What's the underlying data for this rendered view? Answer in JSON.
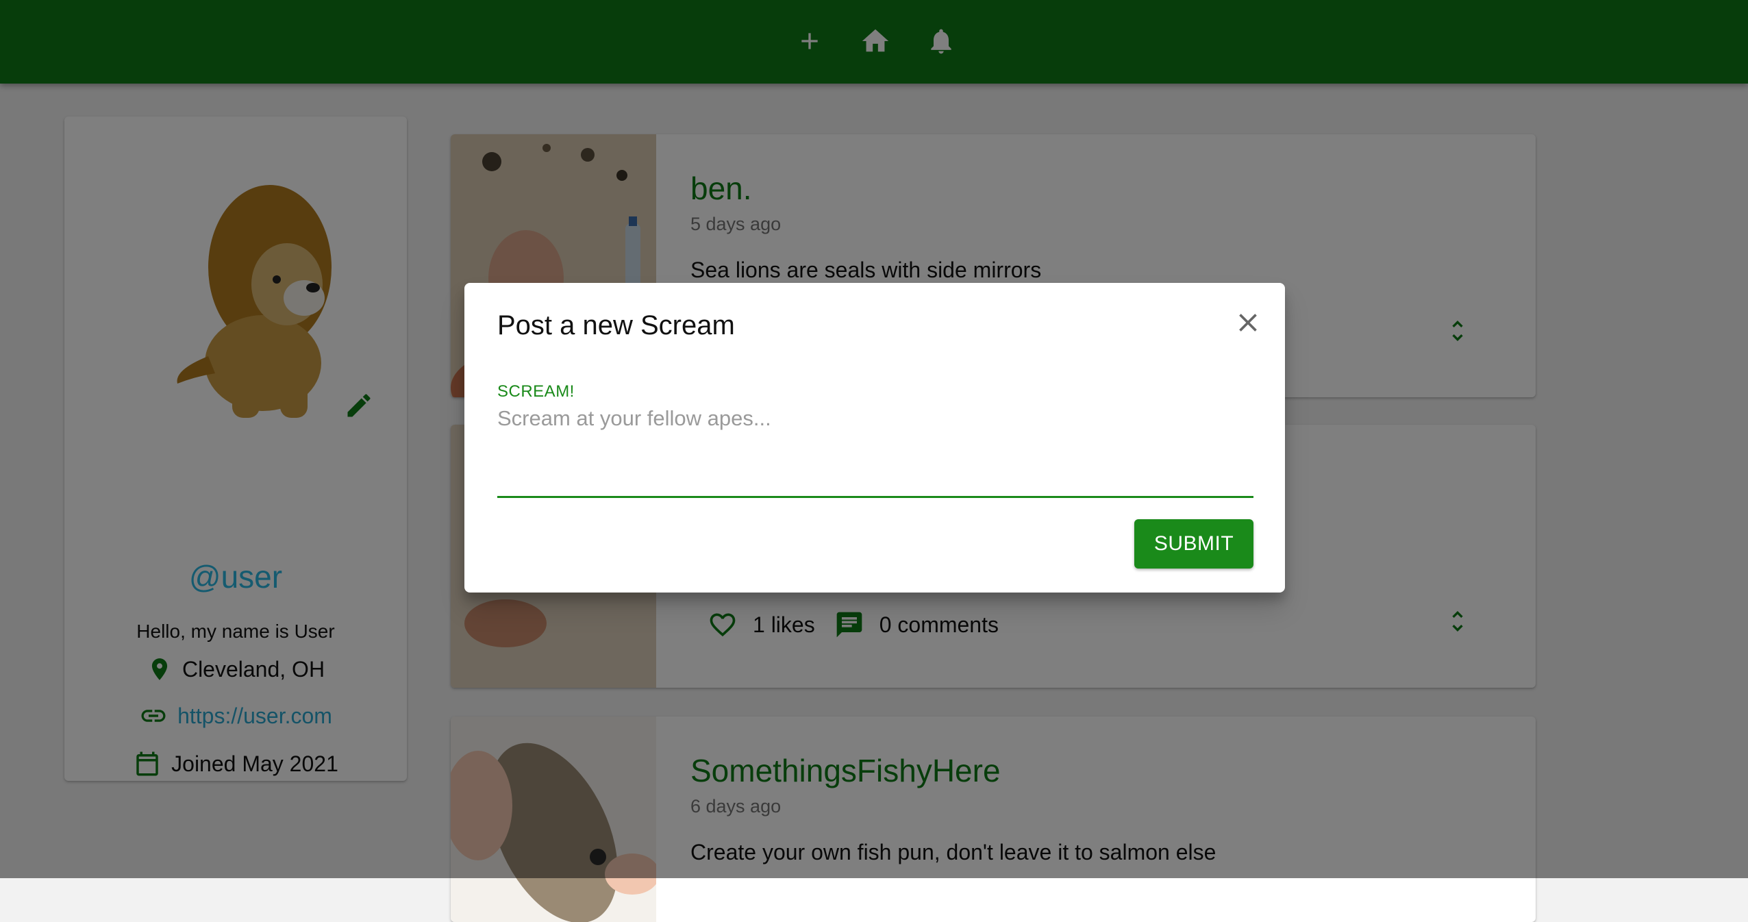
{
  "colors": {
    "primary": "#0f7a17",
    "accent": "#1a8a1a",
    "link": "#2ba7cf"
  },
  "navbar": {
    "icons": [
      "plus-icon",
      "home-icon",
      "bell-icon"
    ]
  },
  "profile": {
    "handle": "@user",
    "bio": "Hello, my name is User",
    "location": "Cleveland, OH",
    "website": "https://user.com",
    "joined": "Joined May 2021"
  },
  "screams": [
    {
      "author": "ben.",
      "date": "5 days ago",
      "body": "Sea lions are seals with side mirrors"
    },
    {
      "likes": "1 likes",
      "comments": "0 comments"
    },
    {
      "author": "SomethingsFishyHere",
      "date": "6 days ago",
      "body": "Create your own fish pun, don't leave it to salmon else"
    }
  ],
  "dialog": {
    "title": "Post a new Scream",
    "field_label": "SCREAM!",
    "placeholder": "Scream at your fellow apes...",
    "value": "",
    "submit_label": "SUBMIT"
  }
}
